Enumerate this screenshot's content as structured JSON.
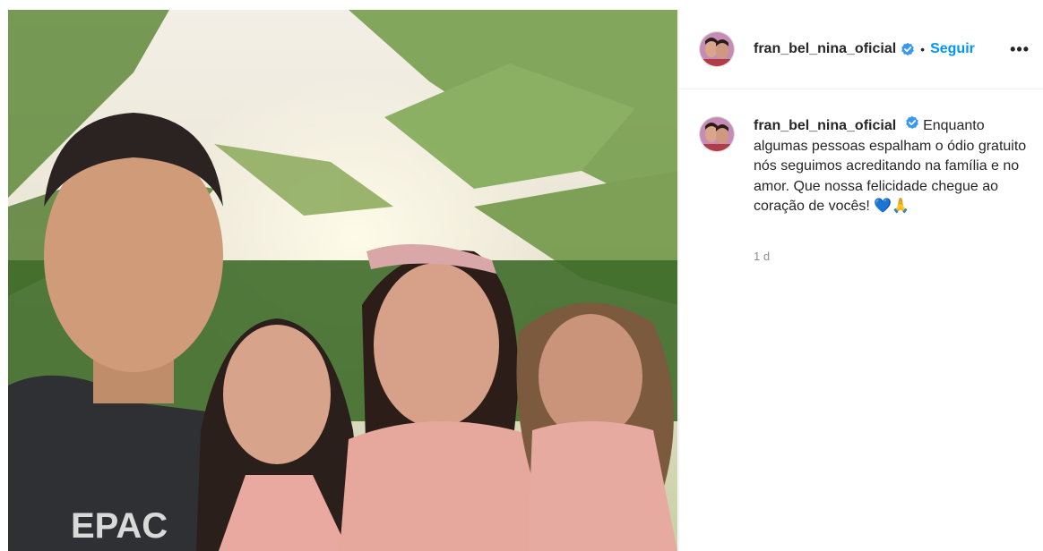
{
  "post": {
    "image_alt": "Foto de família com palmeiras ao fundo"
  },
  "header": {
    "username": "fran_bel_nina_oficial",
    "separator": "•",
    "follow_label": "Seguir",
    "more_label": "•••"
  },
  "caption": {
    "username": "fran_bel_nina_oficial",
    "text": "Enquanto algumas pessoas espalham o ódio gratuito nós seguimos acreditando na família e no amor. Que nossa felicidade chegue ao coração de vocês!",
    "emoji_heart": "💙",
    "emoji_pray": "🙏",
    "time": "1 d"
  },
  "colors": {
    "accent": "#0095f6",
    "verified": "#3897f0"
  }
}
